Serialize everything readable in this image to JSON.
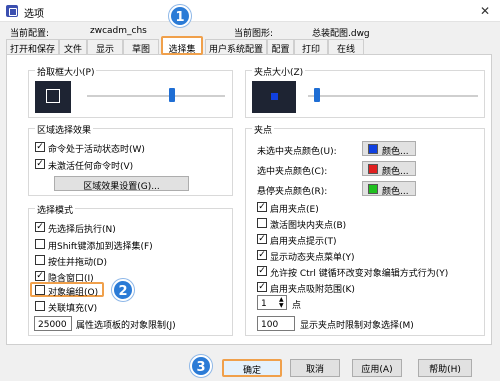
{
  "window": {
    "title": "选项",
    "close_glyph": "✕"
  },
  "meta": {
    "current_config_label": "当前配置:",
    "current_config_value": "zwcadm_chs",
    "current_drawing_label": "当前图形:",
    "current_drawing_value": "总装配图.dwg"
  },
  "tabs": [
    "打开和保存",
    "文件",
    "显示",
    "草图",
    "选择集",
    "用户系统配置",
    "配置",
    "打印",
    "在线"
  ],
  "active_tab": "选择集",
  "pickbox": {
    "title": "拾取框大小(P)"
  },
  "grip_size": {
    "title": "夹点大小(Z)"
  },
  "selection_effect": {
    "title": "区域选择效果",
    "items": [
      {
        "label": "命令处于活动状态时(W)",
        "checked": true
      },
      {
        "label": "未激活任何命令时(V)",
        "checked": true
      }
    ],
    "button": "区域效果设置(G)..."
  },
  "selection_mode": {
    "title": "选择模式",
    "items": [
      {
        "label": "先选择后执行(N)",
        "checked": true
      },
      {
        "label": "用Shift键添加到选择集(F)",
        "checked": false
      },
      {
        "label": "按住并拖动(D)",
        "checked": false
      },
      {
        "label": "隐含窗口(I)",
        "checked": true
      },
      {
        "label": "对象编组(O)",
        "checked": false
      },
      {
        "label": "关联填充(V)",
        "checked": false
      }
    ],
    "limit_value": "25000",
    "limit_label": "属性选项板的对象限制(J)"
  },
  "grips": {
    "title": "夹点",
    "unselected": {
      "label": "未选中夹点颜色(U):",
      "color_name": "颜色...",
      "color": "#1040e0"
    },
    "selected": {
      "label": "选中夹点颜色(C):",
      "color_name": "颜色...",
      "color": "#e02020"
    },
    "hover": {
      "label": "悬停夹点颜色(R):",
      "color_name": "颜色...",
      "color": "#20c020"
    },
    "items": [
      {
        "label": "启用夹点(E)",
        "checked": true
      },
      {
        "label": "激活图块内夹点(B)",
        "checked": false
      },
      {
        "label": "启用夹点提示(T)",
        "checked": true
      },
      {
        "label": "显示动态夹点菜单(Y)",
        "checked": true
      },
      {
        "label": "允许按 Ctrl 键循环改变对象编辑方式行为(Y)",
        "checked": true
      },
      {
        "label": "启用夹点吸附范围(K)",
        "checked": true
      }
    ],
    "snap_value": "1",
    "snap_unit": "点",
    "limit_value": "100",
    "limit_label": "显示夹点时限制对象选择(M)"
  },
  "footer": {
    "ok": "确定",
    "cancel": "取消",
    "apply": "应用(A)",
    "help": "帮助(H)"
  },
  "markers": [
    "1",
    "2",
    "3"
  ]
}
